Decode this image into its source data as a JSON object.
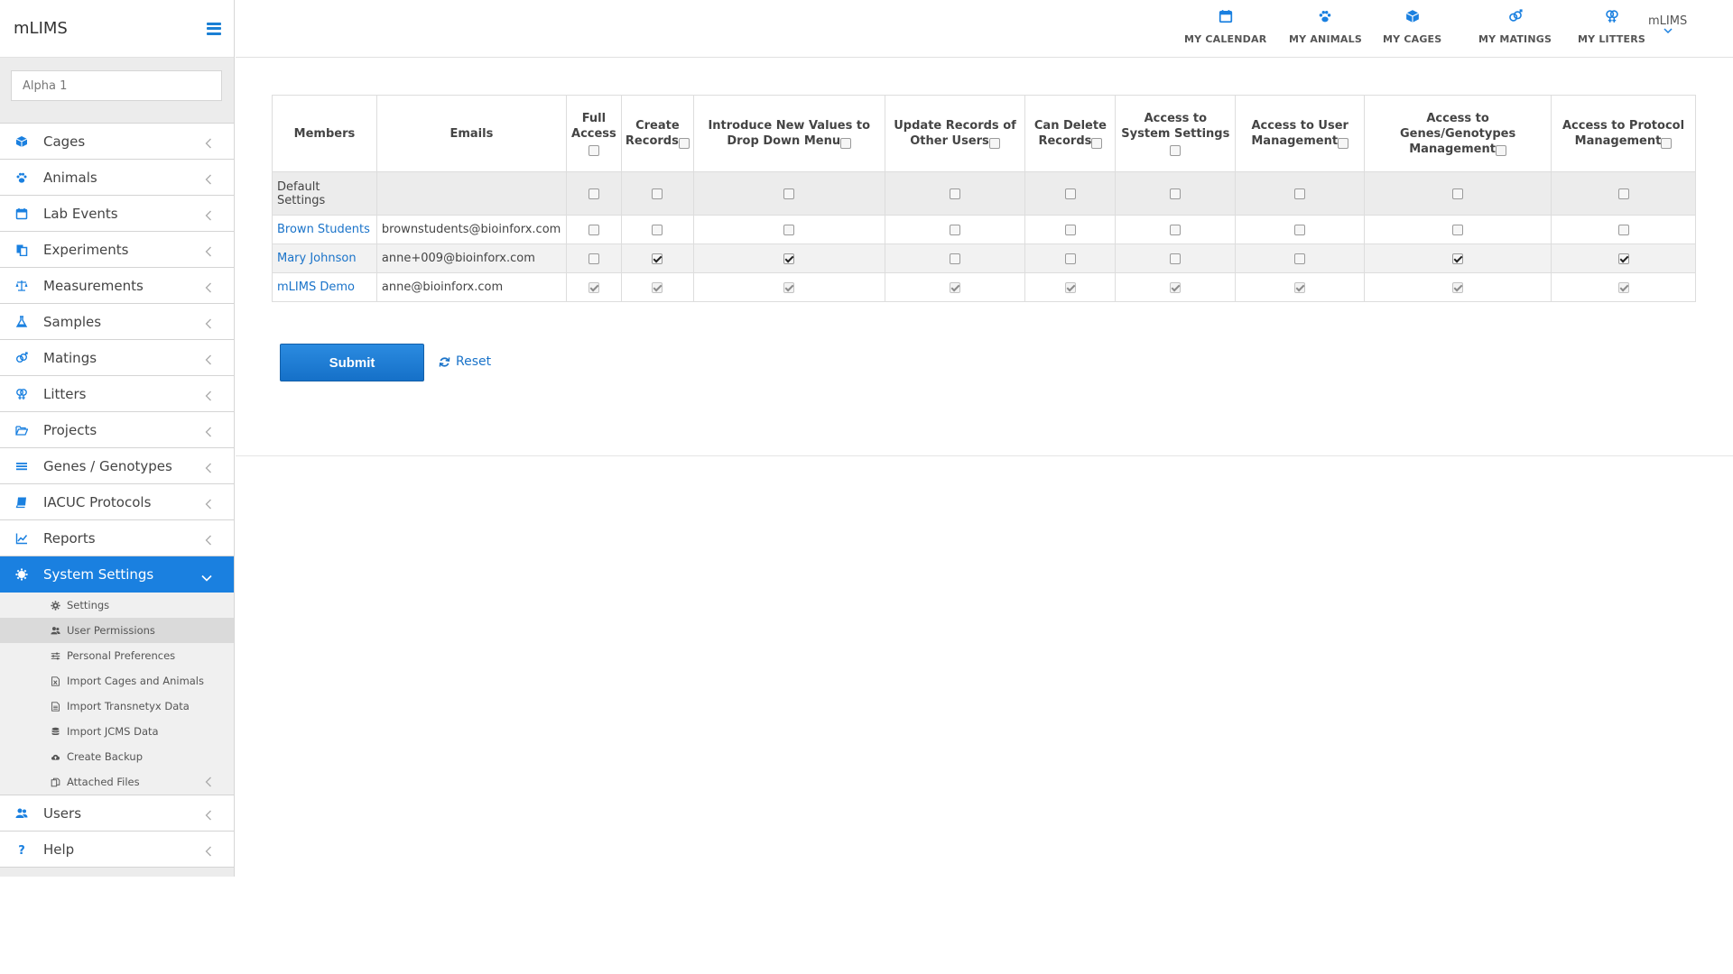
{
  "app": {
    "brand": "mLIMS",
    "workspace": "Alpha 1"
  },
  "topnav": [
    {
      "label": "MY CALENDAR",
      "icon": "calendar-icon"
    },
    {
      "label": "MY ANIMALS",
      "icon": "paw-icon"
    },
    {
      "label": "MY CAGES",
      "icon": "cube-icon"
    },
    {
      "label": "MY MATINGS",
      "icon": "mating-icon"
    },
    {
      "label": "MY LITTERS",
      "icon": "litter-icon"
    }
  ],
  "user": {
    "label": "mLIMS"
  },
  "sidebar": {
    "items": [
      {
        "label": "Cages",
        "icon": "cube-icon"
      },
      {
        "label": "Animals",
        "icon": "paw-icon"
      },
      {
        "label": "Lab Events",
        "icon": "calendar-icon"
      },
      {
        "label": "Experiments",
        "icon": "experiments-icon"
      },
      {
        "label": "Measurements",
        "icon": "balance-icon"
      },
      {
        "label": "Samples",
        "icon": "flask-icon"
      },
      {
        "label": "Matings",
        "icon": "mating-icon"
      },
      {
        "label": "Litters",
        "icon": "litter-icon"
      },
      {
        "label": "Projects",
        "icon": "folder-open-icon"
      },
      {
        "label": "Genes / Genotypes",
        "icon": "list-icon"
      },
      {
        "label": "IACUC Protocols",
        "icon": "book-icon"
      },
      {
        "label": "Reports",
        "icon": "line-chart-icon"
      },
      {
        "label": "System Settings",
        "icon": "gear-icon"
      }
    ],
    "sub_items": [
      {
        "label": "Settings",
        "icon": "gear-icon"
      },
      {
        "label": "User Permissions",
        "icon": "users-icon"
      },
      {
        "label": "Personal Preferences",
        "icon": "sliders-icon"
      },
      {
        "label": "Import Cages and Animals",
        "icon": "excel-file-icon"
      },
      {
        "label": "Import Transnetyx Data",
        "icon": "file-text-icon"
      },
      {
        "label": "Import JCMS Data",
        "icon": "database-icon"
      },
      {
        "label": "Create Backup",
        "icon": "cloud-upload-icon"
      },
      {
        "label": "Attached Files",
        "icon": "copy-icon"
      }
    ],
    "bottom_items": [
      {
        "label": "Users",
        "icon": "users-icon"
      },
      {
        "label": "Help",
        "icon": "question-icon"
      }
    ]
  },
  "table": {
    "headers": [
      "Members",
      "Emails",
      "Full Access",
      "Create Records",
      "Introduce New Values to Drop Down Menu",
      "Update Records of Other Users",
      "Can Delete Records",
      "Access to System Settings",
      "Access to User Management",
      "Access to Genes/Genotypes Management",
      "Access to Protocol Management"
    ],
    "rows": [
      {
        "member": "Default Settings",
        "email": "",
        "link": false,
        "disabled": false,
        "perms": [
          false,
          false,
          false,
          false,
          false,
          false,
          false,
          false,
          false
        ]
      },
      {
        "member": "Brown Students",
        "email": "brownstudents@bioinforx.com",
        "link": true,
        "disabled": false,
        "perms": [
          false,
          false,
          false,
          false,
          false,
          false,
          false,
          false,
          false
        ]
      },
      {
        "member": "Mary Johnson",
        "email": "anne+009@bioinforx.com",
        "link": true,
        "disabled": false,
        "perms": [
          false,
          true,
          true,
          false,
          false,
          false,
          false,
          true,
          true
        ]
      },
      {
        "member": "mLIMS Demo",
        "email": "anne@bioinforx.com",
        "link": true,
        "disabled": true,
        "perms": [
          true,
          true,
          true,
          true,
          true,
          true,
          true,
          true,
          true
        ]
      }
    ]
  },
  "actions": {
    "submit": "Submit",
    "reset": "Reset"
  },
  "colors": {
    "accent": "#1a80e0",
    "link": "#1a73c9"
  }
}
